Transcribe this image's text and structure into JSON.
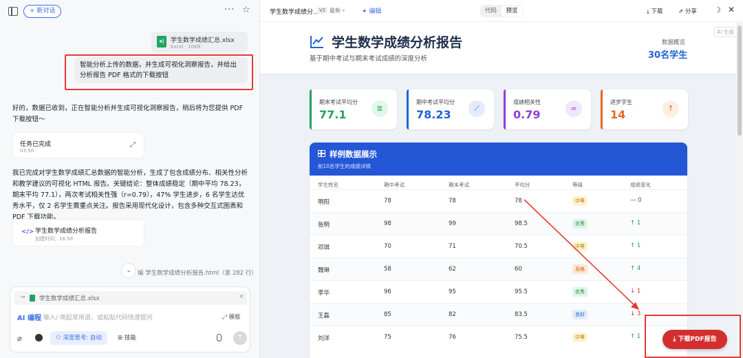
{
  "left": {
    "new_chat": "+ 新对话",
    "more": "···",
    "file": {
      "name": "学生数学成绩汇总.xlsx",
      "meta": "Excel · 10KB"
    },
    "user_message": "智能分析上传的数据，并生成可视化洞察报告，并给出分析报告 PDF 格式的下载按钮",
    "ai_reply_1": "好的，数据已收到，正在智能分析并生成可视化洞察报告，稍后将为您提供 PDF 下载按钮～",
    "task": {
      "title": "任务已完成",
      "time": "03:50"
    },
    "ai_reply_2": "我已完成对学生数学成绩汇总数据的智能分析，生成了包含成绩分布、相关性分析和教学建议的可视化 HTML 报告。关键结论：整体成绩稳定（期中平均 78.23，期末平均 77.1），两次考试相关性强（r=0.79），47% 学生进步，6 名学生达优秀水平，仅 2 名学生需重点关注。报告采用现代化设计，包含多种交互式图表和 PDF 下载功能。",
    "report": {
      "title": "学生数学成绩分析报告",
      "time": "创建时间：16:58"
    },
    "status_line": "编 学生数学成绩分析报告.html（第 282 行）",
    "input": {
      "attached": "学生数学成绩汇总.xlsx",
      "mode": "AI 编程",
      "placeholder": "输入/ 唤起常用语，或粘贴代码快速提问",
      "template": "模板",
      "think": "深度思考: 自动",
      "skill": "技能"
    }
  },
  "right": {
    "top": {
      "title": "学生数学成绩分...",
      "version": "V2",
      "version_label": "最新",
      "edit": "编辑",
      "code": "代码",
      "preview": "预览",
      "download": "下载",
      "share": "分享"
    },
    "report": {
      "title": "学生数学成绩分析报告",
      "subtitle": "基于期中考试与期末考试成绩的深度分析",
      "overview_label": "数据概览",
      "overview_value": "30名学生",
      "ai_gen": "AI 生成",
      "stats": [
        {
          "label": "期末考试平均分",
          "value": "77.1",
          "color": "#22a35a",
          "bg": "#e3f6ea",
          "icon": "bar-chart-icon",
          "glyph": "≣"
        },
        {
          "label": "期中考试平均分",
          "value": "78.23",
          "color": "#1e63d6",
          "bg": "#e4ecfb",
          "icon": "line-chart-icon",
          "glyph": "⟋"
        },
        {
          "label": "成绩相关性",
          "value": "0.79",
          "color": "#8e3fd6",
          "bg": "#f1e6fb",
          "icon": "link-icon",
          "glyph": "∞"
        },
        {
          "label": "进步学生",
          "value": "14",
          "color": "#e8681f",
          "bg": "#fdeee2",
          "icon": "arrow-up-icon",
          "glyph": "↑"
        }
      ],
      "table": {
        "title": "样例数据展示",
        "subtitle": "前10名学生的成绩详情",
        "headers": [
          "学生姓名",
          "期中考试",
          "期末考试",
          "平均分",
          "等级",
          "成绩变化"
        ],
        "rows": [
          {
            "name": "明阳",
            "mid": "78",
            "final": "78",
            "avg": "78",
            "grade": "中等",
            "gc": "#b07a00",
            "gb": "#fff3cf",
            "change": "— 0",
            "cc": "#555"
          },
          {
            "name": "张明",
            "mid": "98",
            "final": "99",
            "avg": "98.5",
            "grade": "优秀",
            "gc": "#1e8a45",
            "gb": "#dff5e6",
            "change": "↑ 1",
            "cc": "#1e9e4f"
          },
          {
            "name": "邓琪",
            "mid": "70",
            "final": "71",
            "avg": "70.5",
            "grade": "中等",
            "gc": "#b07a00",
            "gb": "#fff3cf",
            "change": "↑ 1",
            "cc": "#1e9e4f"
          },
          {
            "name": "魏琳",
            "mid": "58",
            "final": "62",
            "avg": "60",
            "grade": "及格",
            "gc": "#c85a00",
            "gb": "#ffe7d4",
            "change": "↑ 4",
            "cc": "#1e9e4f"
          },
          {
            "name": "李华",
            "mid": "96",
            "final": "95",
            "avg": "95.5",
            "grade": "优秀",
            "gc": "#1e8a45",
            "gb": "#dff5e6",
            "change": "↓ 1",
            "cc": "#d32f2f"
          },
          {
            "name": "王磊",
            "mid": "85",
            "final": "82",
            "avg": "83.5",
            "grade": "良好",
            "gc": "#1e63d6",
            "gb": "#e2ecfc",
            "change": "↓ 3",
            "cc": "#d32f2f"
          },
          {
            "name": "刘洋",
            "mid": "75",
            "final": "76",
            "avg": "75.5",
            "grade": "中等",
            "gc": "#b07a00",
            "gb": "#fff3cf",
            "change": "↑ 1",
            "cc": "#1e9e4f"
          }
        ]
      },
      "pdf_button": "下载PDF报告"
    }
  }
}
